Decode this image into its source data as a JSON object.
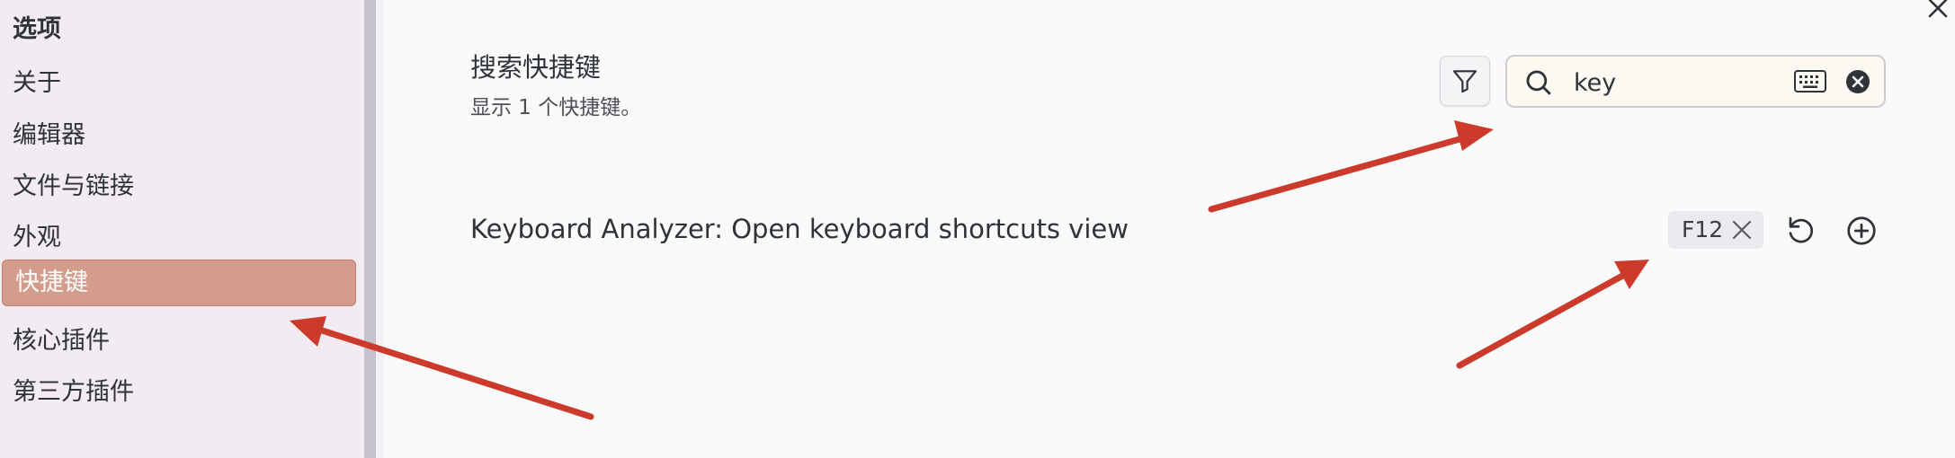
{
  "sidebar": {
    "section_title": "选项",
    "items": [
      {
        "label": "关于"
      },
      {
        "label": "编辑器"
      },
      {
        "label": "文件与链接"
      },
      {
        "label": "外观"
      },
      {
        "label": "快捷键",
        "active": true
      },
      {
        "label": "核心插件"
      },
      {
        "label": "第三方插件"
      }
    ]
  },
  "main": {
    "title": "搜索快捷键",
    "subtitle": "显示 1 个快捷键。",
    "search": {
      "value": "key"
    },
    "commands": [
      {
        "name": "Keyboard Analyzer: Open keyboard shortcuts view",
        "hotkey": "F12"
      }
    ]
  },
  "icons": {
    "filter": "filter-icon",
    "search": "search-icon",
    "keyboard": "keyboard-icon",
    "clear": "clear-search-icon",
    "remove_hotkey": "remove-hotkey-icon",
    "reset": "reset-icon",
    "add": "add-hotkey-icon",
    "close": "close-icon"
  },
  "colors": {
    "active_item_bg": "#d49c8b",
    "annotation_arrow": "#cc3a2c",
    "sidebar_bg": "#f3ebf2"
  }
}
